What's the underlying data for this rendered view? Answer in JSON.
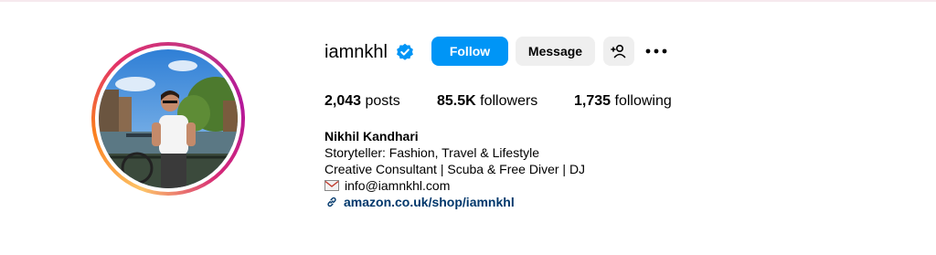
{
  "profile": {
    "username": "iamnkhl",
    "verified": true,
    "buttons": {
      "follow": "Follow",
      "message": "Message"
    },
    "stats": {
      "posts_count": "2,043",
      "posts_label": "posts",
      "followers_count": "85.5K",
      "followers_label": "followers",
      "following_count": "1,735",
      "following_label": "following"
    },
    "bio": {
      "name": "Nikhil Kandhari",
      "line1": "Storyteller: Fashion, Travel & Lifestyle",
      "line2": "Creative Consultant | Scuba & Free Diver | DJ",
      "email": "info@iamnkhl.com",
      "link": "amazon.co.uk/shop/iamnkhl"
    }
  },
  "colors": {
    "follow_button": "#0095f6",
    "secondary_button": "#efefef",
    "verified_badge": "#0095f6",
    "link": "#00376b"
  },
  "icons": {
    "verified": "verified-badge-icon",
    "add_user": "add-user-icon",
    "more": "more-options-icon",
    "mail": "mail-icon",
    "link": "link-icon"
  }
}
